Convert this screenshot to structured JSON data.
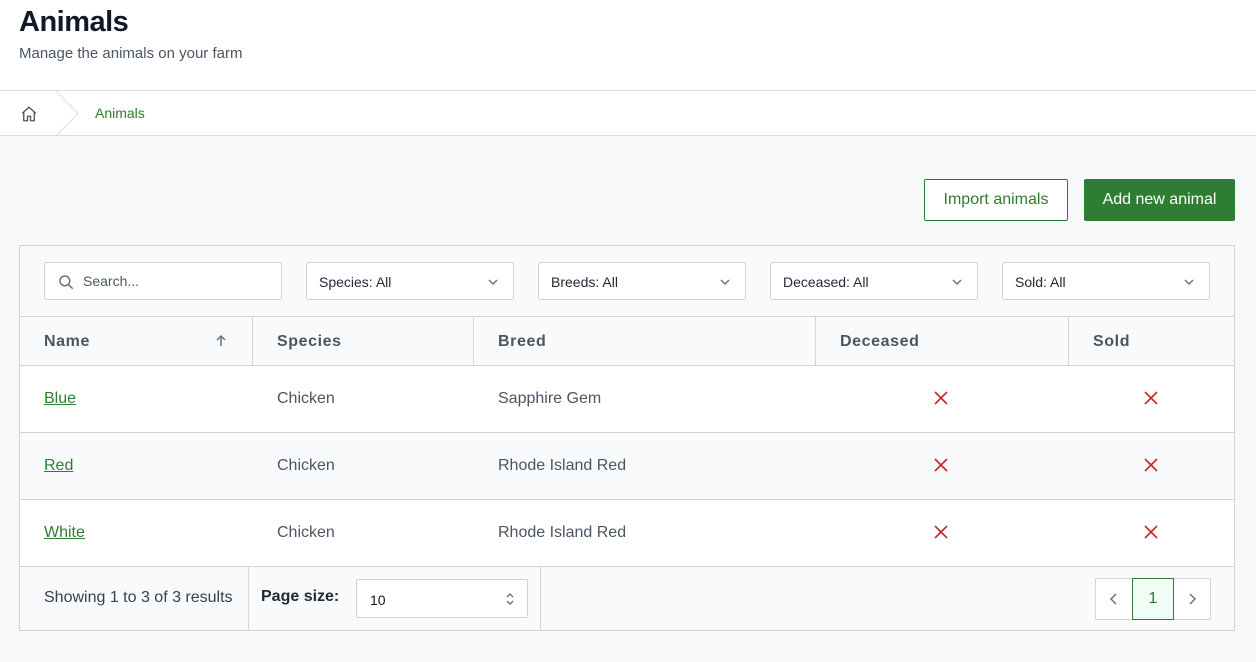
{
  "header": {
    "title": "Animals",
    "subtitle": "Manage the animals on your farm"
  },
  "breadcrumb": {
    "home_icon": "home-icon",
    "current": "Animals"
  },
  "actions": {
    "import_label": "Import animals",
    "add_label": "Add new animal"
  },
  "filters": {
    "search_placeholder": "Search...",
    "search_value": "",
    "species": "Species: All",
    "breeds": "Breeds: All",
    "deceased": "Deceased: All",
    "sold": "Sold: All"
  },
  "table": {
    "columns": [
      "Name",
      "Species",
      "Breed",
      "Deceased",
      "Sold"
    ],
    "sort": {
      "column": "Name",
      "direction": "ascending"
    },
    "rows": [
      {
        "name": "Blue",
        "species": "Chicken",
        "breed": "Sapphire Gem",
        "deceased": false,
        "sold": false
      },
      {
        "name": "Red",
        "species": "Chicken",
        "breed": "Rhode Island Red",
        "deceased": false,
        "sold": false
      },
      {
        "name": "White",
        "species": "Chicken",
        "breed": "Rhode Island Red",
        "deceased": false,
        "sold": false
      }
    ]
  },
  "footer": {
    "showing": "Showing 1 to 3 of 3 results",
    "page_size_label": "Page size:",
    "page_size_value": "10",
    "current_page": "1"
  },
  "colors": {
    "brand_green": "#2e7d32",
    "false_mark_red": "#c62828",
    "border": "#d1d5db"
  }
}
